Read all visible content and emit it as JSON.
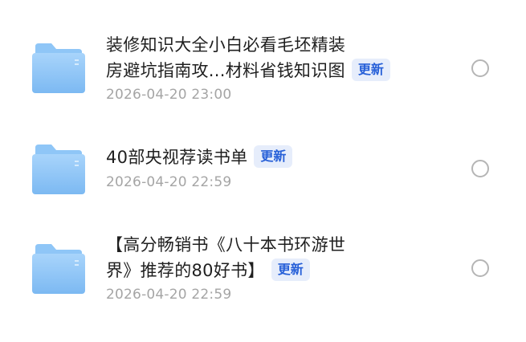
{
  "files": [
    {
      "icon": "folder-icon",
      "title_line1": "装修知识大全小白必看毛坯精装",
      "title_line2": "房避坑指南攻...材料省钱知识图",
      "badge": "更新",
      "date": "2026-04-20 23:00"
    },
    {
      "icon": "folder-icon",
      "title_line1": "40部央视荐读书单",
      "badge": "更新",
      "date": "2026-04-20 22:59"
    },
    {
      "icon": "folder-icon",
      "title_line1": "【高分畅销书《八十本书环游世",
      "title_line2": "界》推荐的80好书】",
      "badge": "更新",
      "date": "2026-04-20 22:59"
    }
  ],
  "colors": {
    "folder_light": "#b7dcfb",
    "folder_dark": "#7fbdf3",
    "badge_text": "#2760d8",
    "badge_bg": "#e6edfb",
    "date_text": "#a5a5a5"
  }
}
